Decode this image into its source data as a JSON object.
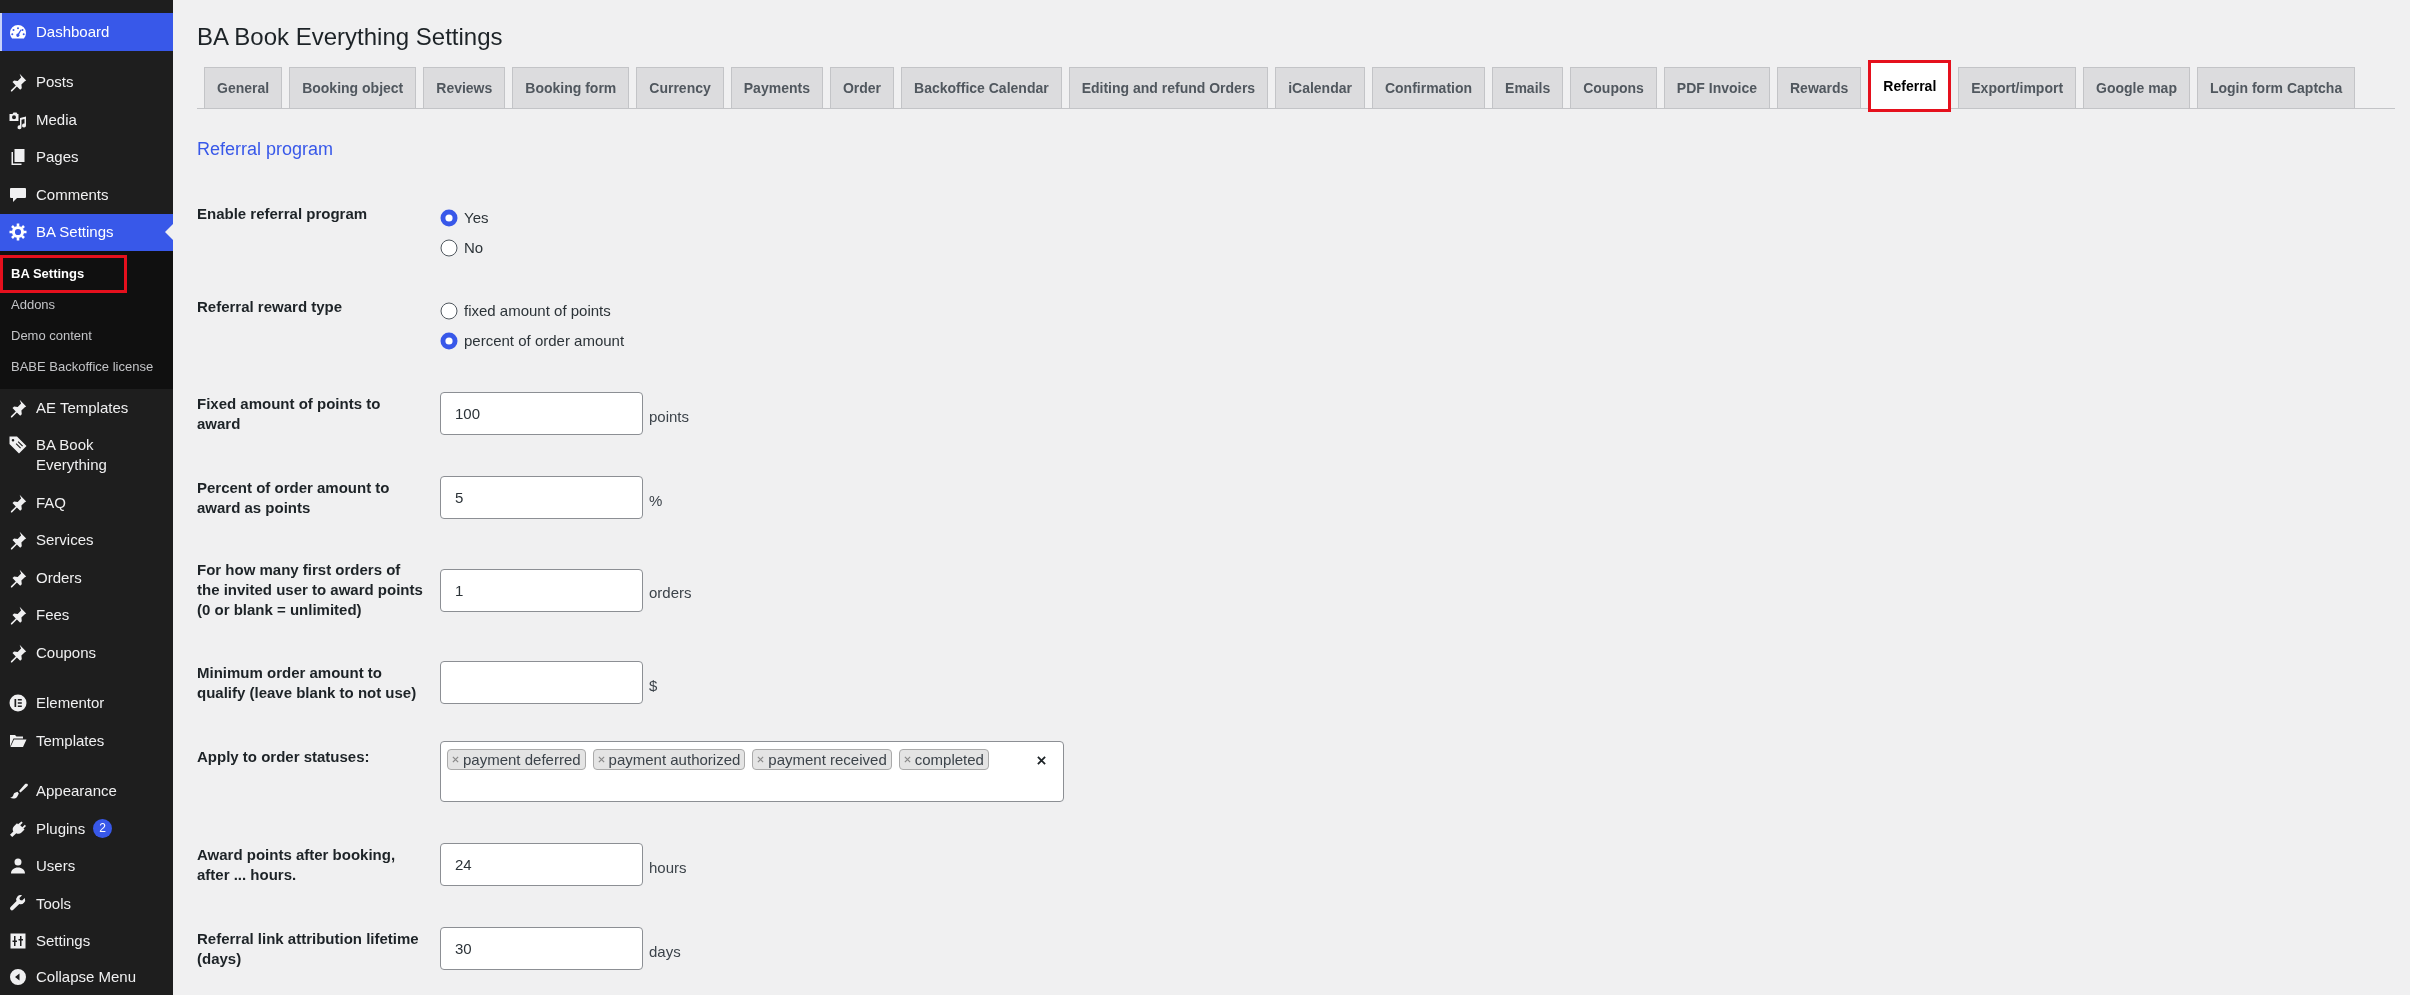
{
  "sidebar": {
    "menu_groups": [
      {
        "items": [
          {
            "label": "Dashboard",
            "selected": false,
            "hovered": true
          }
        ]
      },
      {
        "items": [
          {
            "label": "Posts",
            "selected": false,
            "hovered": false
          },
          {
            "label": "Media",
            "selected": false,
            "hovered": false
          },
          {
            "label": "Pages",
            "selected": false,
            "hovered": false
          },
          {
            "label": "Comments",
            "selected": false,
            "hovered": false
          },
          {
            "label": "BA Settings",
            "selected": true,
            "hovered": false,
            "submenu": [
              {
                "label": "BA Settings",
                "selected": true,
                "framed": true
              },
              {
                "label": "Addons",
                "selected": false,
                "framed": false
              },
              {
                "label": "Demo content",
                "selected": false,
                "framed": false
              },
              {
                "label": "BABE Backoffice license",
                "selected": false,
                "framed": false
              }
            ]
          },
          {
            "label": "AE Templates",
            "selected": false,
            "hovered": false
          },
          {
            "label": "BA Book Everything",
            "selected": false,
            "hovered": false
          },
          {
            "label": "FAQ",
            "selected": false,
            "hovered": false
          },
          {
            "label": "Services",
            "selected": false,
            "hovered": false
          },
          {
            "label": "Orders",
            "selected": false,
            "hovered": false
          },
          {
            "label": "Fees",
            "selected": false,
            "hovered": false
          },
          {
            "label": "Coupons",
            "selected": false,
            "hovered": false
          }
        ]
      },
      {
        "items": [
          {
            "label": "Elementor",
            "selected": false,
            "hovered": false
          },
          {
            "label": "Templates",
            "selected": false,
            "hovered": false
          }
        ]
      },
      {
        "items": [
          {
            "label": "Appearance",
            "selected": false,
            "hovered": false
          },
          {
            "label": "Plugins",
            "selected": false,
            "hovered": false,
            "badge": "2"
          },
          {
            "label": "Users",
            "selected": false,
            "hovered": false
          },
          {
            "label": "Tools",
            "selected": false,
            "hovered": false
          },
          {
            "label": "Settings",
            "selected": false,
            "hovered": false
          }
        ]
      }
    ],
    "collapse_label": "Collapse Menu"
  },
  "page": {
    "title": "BA Book Everything Settings",
    "tabs": [
      {
        "label": "General",
        "selected": false,
        "framed": false
      },
      {
        "label": "Booking object",
        "selected": false,
        "framed": false
      },
      {
        "label": "Reviews",
        "selected": false,
        "framed": false
      },
      {
        "label": "Booking form",
        "selected": false,
        "framed": false
      },
      {
        "label": "Currency",
        "selected": false,
        "framed": false
      },
      {
        "label": "Payments",
        "selected": false,
        "framed": false
      },
      {
        "label": "Order",
        "selected": false,
        "framed": false
      },
      {
        "label": "Backoffice Calendar",
        "selected": false,
        "framed": false
      },
      {
        "label": "Editing and refund Orders",
        "selected": false,
        "framed": false
      },
      {
        "label": "iCalendar",
        "selected": false,
        "framed": false
      },
      {
        "label": "Confirmation",
        "selected": false,
        "framed": false
      },
      {
        "label": "Emails",
        "selected": false,
        "framed": false
      },
      {
        "label": "Coupons",
        "selected": false,
        "framed": false
      },
      {
        "label": "PDF Invoice",
        "selected": false,
        "framed": false
      },
      {
        "label": "Rewards",
        "selected": false,
        "framed": false
      },
      {
        "label": "Referral",
        "selected": true,
        "framed": true
      },
      {
        "label": "Export/import",
        "selected": false,
        "framed": false
      },
      {
        "label": "Google map",
        "selected": false,
        "framed": false
      },
      {
        "label": "Login form Captcha",
        "selected": false,
        "framed": false
      }
    ],
    "section_title": "Referral program",
    "fields": [
      {
        "kind": "radio",
        "label": "Enable referral program",
        "options": [
          {
            "label": "Yes",
            "selected": true
          },
          {
            "label": "No",
            "selected": false
          }
        ]
      },
      {
        "kind": "radio",
        "label": "Referral reward type",
        "options": [
          {
            "label": "fixed amount of points",
            "selected": false
          },
          {
            "label": "percent of order amount",
            "selected": true
          }
        ]
      },
      {
        "kind": "text",
        "label": "Fixed amount of points to award",
        "value": "100",
        "unit": "points"
      },
      {
        "kind": "text",
        "label": "Percent of order amount to award as points",
        "value": "5",
        "unit": "%"
      },
      {
        "kind": "text",
        "label": "For how many first orders of the invited user to award points (0 or blank = unlimited)",
        "value": "1",
        "unit": "orders"
      },
      {
        "kind": "text",
        "label": "Minimum order amount to qualify (leave blank to not use)",
        "unit": "$"
      },
      {
        "kind": "multiselect",
        "label": "Apply to order statuses:",
        "tags": [
          "payment deferred",
          "payment authorized",
          "payment received",
          "completed"
        ]
      },
      {
        "kind": "text",
        "label": "Award points after booking, after ... hours.",
        "value": "24",
        "unit": "hours"
      },
      {
        "kind": "text",
        "label": "Referral link attribution lifetime (days)",
        "value": "30",
        "unit": "days"
      }
    ]
  }
}
